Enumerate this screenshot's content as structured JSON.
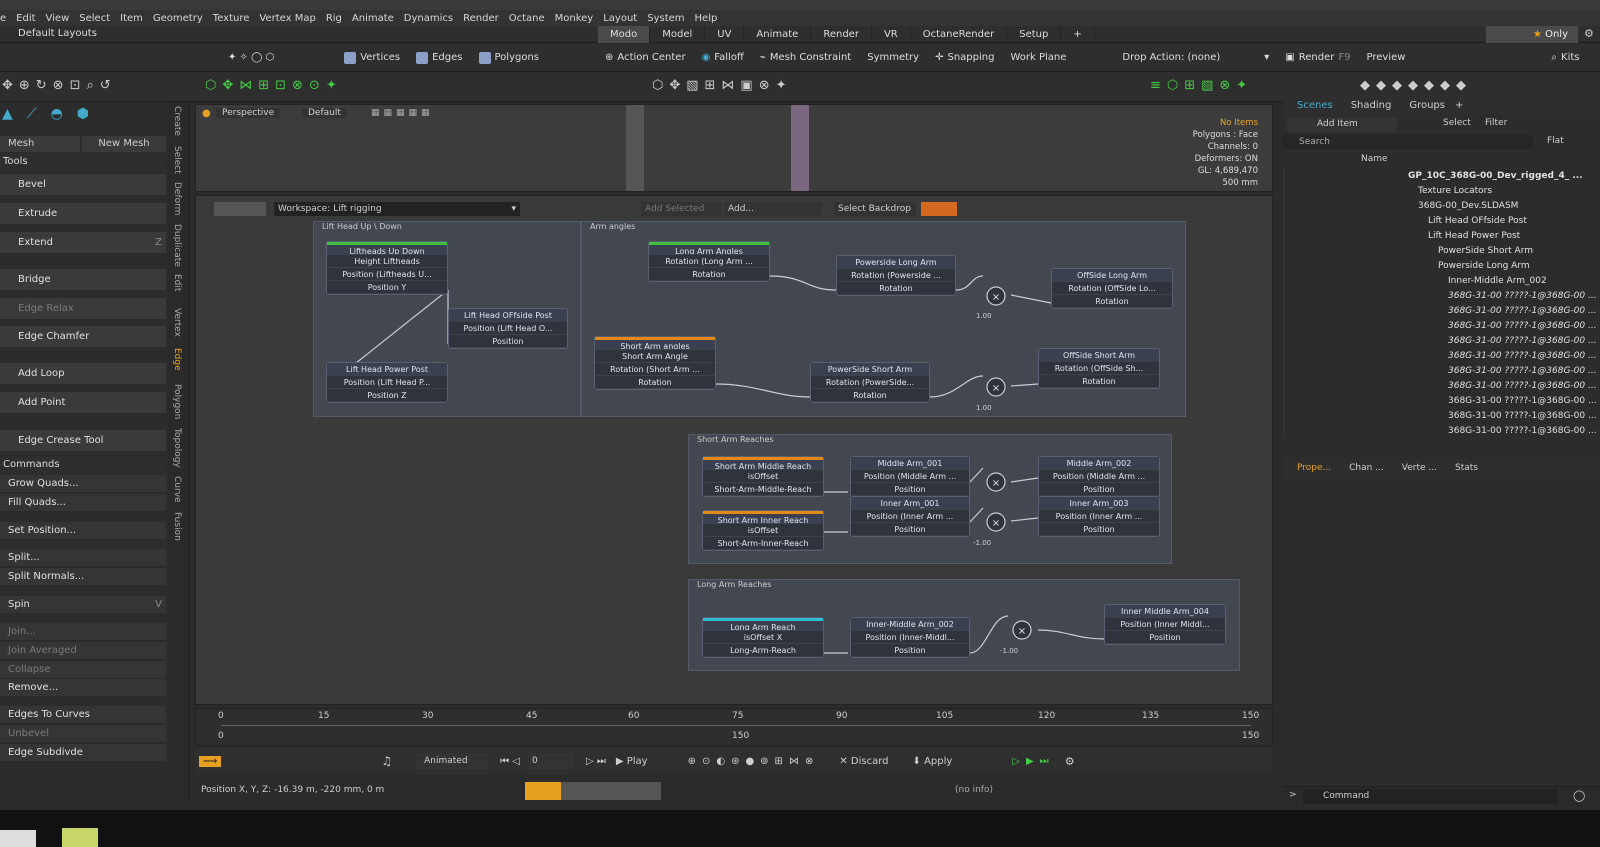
{
  "menu": {
    "items": [
      "e",
      "Edit",
      "View",
      "Select",
      "Item",
      "Geometry",
      "Texture",
      "Vertex Map",
      "Rig",
      "Animate",
      "Dynamics",
      "Render",
      "Octane",
      "Monkey",
      "Layout",
      "System",
      "Help"
    ]
  },
  "layouts": {
    "label": "Default Layouts",
    "tabs": [
      "Modo",
      "Model",
      "UV",
      "Animate",
      "Render",
      "VR",
      "OctaneRender",
      "Setup"
    ],
    "only_label": "Only"
  },
  "toolbar": {
    "vertices": "Vertices",
    "edges": "Edges",
    "polygons": "Polygons",
    "action_center": "Action Center",
    "falloff": "Falloff",
    "mesh_constraint": "Mesh Constraint",
    "symmetry": "Symmetry",
    "snapping": "Snapping",
    "work_plane": "Work Plane",
    "drop_action": "Drop Action: (none)",
    "render": "Render",
    "render_key": "F9",
    "preview": "Preview",
    "kits": "Kits"
  },
  "leftpanel": {
    "mesh_cleanup": "Mesh Cleanup...",
    "new_mesh": "New Mesh",
    "tools_header": "Tools",
    "tools": [
      "Bevel",
      "Extrude",
      "Extend",
      "Bridge",
      "Edge Relax",
      "Edge Chamfer",
      "Add Loop",
      "Add Point",
      "Edge Crease Tool"
    ],
    "extend_key": "Z",
    "commands_header": "Commands",
    "commands": [
      "Grow Quads...",
      "Fill Quads...",
      "Set Position...",
      "Split...",
      "Split Normals...",
      "Spin",
      "Join...",
      "Join Averaged",
      "Collapse",
      "Remove...",
      "Edges To Curves",
      "Unbevel",
      "Edge Subdivde"
    ],
    "spin_key": "V",
    "vtabs": [
      "Create",
      "Select",
      "Deform",
      "Duplicate",
      "Edit",
      "Vertex",
      "Edge",
      "Polygon",
      "Topology",
      "Curve",
      "Fusion"
    ]
  },
  "viewport": {
    "perspective": "Perspective",
    "default": "Default",
    "info": [
      "No Items",
      "Polygons : Face",
      "Channels: 0",
      "Deformers: ON",
      "GL: 4,689,470",
      "500 mm"
    ]
  },
  "schematic": {
    "workspace": "Workspace: Lift rigging",
    "add_selected": "Add Selected",
    "add": "Add...",
    "select_backdrop": "Select Backdrop",
    "groups": [
      "Lift Head Up \\ Down",
      "Arm angles",
      "Short Arm Reaches",
      "Long Arm Reaches"
    ],
    "nodes": {
      "n1": [
        "Liftheads Up Down",
        "Height Liftheads",
        "Position (Liftheads U...",
        "Position Y"
      ],
      "n2": [
        "Lift Head OFfside Post",
        "Position (Lift Head O...",
        "Position"
      ],
      "n3": [
        "Lift Head Power Post",
        "Position (Lift Head P...",
        "Position Z"
      ],
      "n4": [
        "Long Arm Angles",
        "Rotation (Long Arm ...",
        "Rotation"
      ],
      "n5": [
        "Powerside Long Arm",
        "Rotation (Powerside ...",
        "Rotation"
      ],
      "n6": [
        "OffSide Long Arm",
        "Rotation (OffSide Lo...",
        "Rotation"
      ],
      "n7": [
        "Short Arm angles",
        "Short Arm Angle",
        "Rotation (Short Arm ...",
        "Rotation"
      ],
      "n8": [
        "PowerSide Short Arm",
        "Rotation (PowerSide...",
        "Rotation"
      ],
      "n9": [
        "OffSide Short Arm",
        "Rotation (OffSide Sh...",
        "Rotation"
      ],
      "n10": [
        "Short Arm Middle Reach",
        "isOffset",
        "Short-Arm-Middle-Reach"
      ],
      "n11": [
        "Middle Arm_001",
        "Position (Middle Arm ...",
        "Position"
      ],
      "n12": [
        "Middle Arm_002",
        "Position (Middle Arm ...",
        "Position"
      ],
      "n13": [
        "Short Arm Inner Reach",
        "isOffset",
        "Short-Arm-Inner-Reach"
      ],
      "n14": [
        "Inner Arm_001",
        "Position (Inner Arm ...",
        "Position"
      ],
      "n15": [
        "Inner Arm_003",
        "Position (Inner Arm ...",
        "Position"
      ],
      "n16": [
        "Long Arm Reach",
        "isOffset X",
        "Long-Arm-Reach"
      ],
      "n17": [
        "Inner-Middle Arm_002",
        "Position (Inner-Middl...",
        "Position"
      ],
      "n18": [
        "Inner Middle Arm_004",
        "Position (Inner Middl...",
        "Position"
      ]
    },
    "mult_value": "1.00",
    "mult_neg": "-1.00"
  },
  "timeline": {
    "ticks": [
      "0",
      "15",
      "30",
      "45",
      "60",
      "75",
      "90",
      "105",
      "120",
      "135",
      "150"
    ],
    "start": "0",
    "end": "150",
    "mid": "150"
  },
  "transport": {
    "animated": "Animated",
    "frame": "0",
    "play": "Play",
    "discard": "Discard",
    "apply": "Apply"
  },
  "status": {
    "position": "Position X, Y, Z:  -16.39 m, -220 mm, 0 m",
    "info": "(no info)"
  },
  "right": {
    "tabs": [
      "Scenes",
      "Shading",
      "Groups"
    ],
    "add_item": "Add Item",
    "select": "Select",
    "filter": "Filter",
    "search": "Search",
    "flat": "Flat",
    "name_col": "Name",
    "items": [
      "GP_10C_368G-00_Dev_rigged_4_ ...",
      "Texture Locators",
      "368G-00_Dev.SLDASM",
      "Lift Head OFfside Post",
      "Lift Head Power Post",
      "PowerSide Short Arm",
      "Powerside Long Arm",
      "Inner-Middle Arm_002",
      "368G-31-00 ?????-1@368G-00 ...",
      "368G-31-00 ?????-1@368G-00 ...",
      "368G-31-00 ?????-1@368G-00 ...",
      "368G-31-00 ?????-1@368G-00 ...",
      "368G-31-00 ?????-1@368G-00 ...",
      "368G-31-00 ?????-1@368G-00 ...",
      "368G-31-00 ?????-1@368G-00 ...",
      "368G-31-00 ?????-1@368G-00 ...",
      "368G-31-00 ?????-1@368G-00 ...",
      "368G-31-00 ?????-1@368G-00 ..."
    ],
    "prop_tabs": [
      "Prope...",
      "Chan ...",
      "Verte ...",
      "Stats"
    ],
    "command": "Command"
  },
  "colors": {
    "accent": "#e8a020",
    "node_green": "#3fbf3f",
    "node_orange": "#e08a1a",
    "node_cyan": "#2fc0d0"
  }
}
